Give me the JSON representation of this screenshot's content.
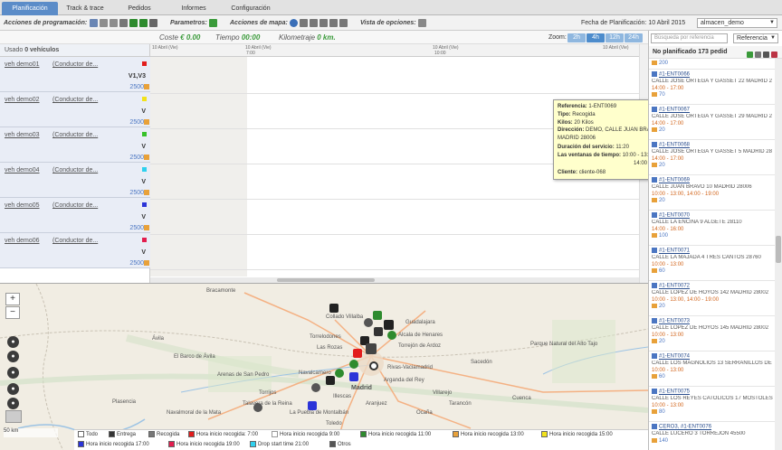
{
  "tabs": [
    "Planificación",
    "Track & trace",
    "Pedidos",
    "Informes",
    "Configuración"
  ],
  "toolbar": {
    "prog_label": "Acciones de programación:",
    "param_label": "Parametros:",
    "map_label": "Acciones de mapa:",
    "view_label": "Vista de opciones:",
    "date_label": "Fecha de Planificación: 10 Abril 2015",
    "warehouse": "almacen_demo"
  },
  "stats": {
    "coste_label": "Coste",
    "coste_value": "€ 0.00",
    "tiempo_label": "Tiempo",
    "tiempo_value": "00:00",
    "km_label": "Kilometraje",
    "km_value": "0 km.",
    "zoom_label": "Zoom:",
    "zoom_options": [
      "2h",
      "4h",
      "12h",
      "24h"
    ]
  },
  "vehicles_header": {
    "label": "Usado",
    "count": "0 vehículos"
  },
  "vehicles": [
    {
      "name": "veh demo01",
      "driver": "(Conductor de...",
      "v": "V1,V3",
      "cap": "2500",
      "color": "#e21d1d"
    },
    {
      "name": "veh demo02",
      "driver": "(Conductor de...",
      "v": "V",
      "cap": "2500",
      "color": "#f2e21a"
    },
    {
      "name": "veh demo03",
      "driver": "(Conductor de...",
      "v": "V",
      "cap": "2500",
      "color": "#36c12b"
    },
    {
      "name": "veh demo04",
      "driver": "(Conductor de...",
      "v": "V",
      "cap": "2500",
      "color": "#2fd0ee"
    },
    {
      "name": "veh demo05",
      "driver": "(Conductor de...",
      "v": "V",
      "cap": "2500",
      "color": "#2b34d8"
    },
    {
      "name": "veh demo06",
      "driver": "(Conductor de...",
      "v": "V",
      "cap": "2500",
      "color": "#e21d4e"
    }
  ],
  "ruler": [
    "10 Abril (Vie)",
    "7:00",
    "10 Abril (Vie)",
    "10:00",
    "10 Abril (Vie)",
    "10 Abril (Vie)"
  ],
  "tooltip": {
    "ref_l": "Referencia:",
    "ref": "1-ENT0069",
    "tipo_l": "Tipo:",
    "tipo": "Recogida",
    "kilos_l": "Kilos:",
    "kilos": "20 Kilos",
    "dir_l": "Dirección:",
    "dir": "DEMO, CALLE JUAN BRAVO 10 MADRID 28006",
    "dur_l": "Duración del servicio:",
    "dur": "11:20",
    "vent_l": "Las ventanas de tiempo:",
    "vent1": "10:00 - 13:00",
    "vent2": "14:00 - 19:00",
    "cli_l": "Cliente:",
    "cli": "cliente-068"
  },
  "right": {
    "search_placeholder": "Búsqueda por referencia",
    "select": "Referencia",
    "header": "No planificado",
    "count": "173 pedid"
  },
  "orders": [
    {
      "ref": "",
      "addr": "",
      "hours": "",
      "kg": "200"
    },
    {
      "ref": "#1-ENT0066",
      "addr": "CALLE JOSE ORTEGA Y GASSET 22 MADRID 2",
      "hours": "14:00 - 17:00",
      "kg": "70"
    },
    {
      "ref": "#1-ENT0067",
      "addr": "CALLE JOSE ORTEGA Y GASSET 29 MADRID 2",
      "hours": "14:00 - 17:00",
      "kg": "20"
    },
    {
      "ref": "#1-ENT0068",
      "addr": "CALLE JOSE ORTEGA Y GASSET 5 MADRID 28",
      "hours": "14:00 - 17:00",
      "kg": "20"
    },
    {
      "ref": "#1-ENT0069",
      "addr": "CALLE JUAN BRAVO 10 MADRID 28006",
      "hours": "10:00 - 13:00, 14:00 - 19:00",
      "kg": "20"
    },
    {
      "ref": "#1-ENT0070",
      "addr": "CALLE LA ENCINA 9 ALGETE 28110",
      "hours": "14:00 - 16:00",
      "kg": "100"
    },
    {
      "ref": "#1-ENT0071",
      "addr": "CALLE LA MAJADA 4 TRES CANTOS 28760",
      "hours": "10:00 - 13:00",
      "kg": "60"
    },
    {
      "ref": "#1-ENT0072",
      "addr": "CALLE LOPEZ DE HOYOS 142 MADRID 28002",
      "hours": "10:00 - 13:00, 14:00 - 19:00",
      "kg": "20"
    },
    {
      "ref": "#1-ENT0073",
      "addr": "CALLE LOPEZ DE HOYOS 145 MADRID 28002",
      "hours": "10:00 - 13:00",
      "kg": "20"
    },
    {
      "ref": "#1-ENT0074",
      "addr": "CALLE LOS MAGNOLIOS 13 SERRANILLOS DE",
      "hours": "10:00 - 13:00",
      "kg": "60"
    },
    {
      "ref": "#1-ENT0075",
      "addr": "CALLE LOS REYES CATOLICOS 17 MOSTOLES",
      "hours": "10:00 - 13:00",
      "kg": "80"
    },
    {
      "ref": "CERO3, #1-ENT0076",
      "addr": "CALLE LUCERO 3 TORREJON 45500",
      "hours": "",
      "kg": "140"
    }
  ],
  "map": {
    "scale": "50 km",
    "cities": [
      "Bracamonte",
      "Collado Villalba",
      "Guadalajara",
      "Alcala de Henares",
      "Torrejón de Ardoz",
      "Las Rozas",
      "Torrelodones",
      "Rivas-Vaciamadrid",
      "Ávila",
      "El Barco de Ávila",
      "Arenas de San Pedro",
      "Navalcarnero",
      "Illescas",
      "Aranjuez",
      "Arganda del Rey",
      "Tarancón",
      "Cuenca",
      "Plasencia",
      "Navalmoral de la Mata",
      "Talavera de la Reina",
      "La Puebla de Montalbán",
      "Toledo",
      "Parque Natural del Alto Tajo",
      "Sacedón",
      "Villarejo",
      "Ocaña",
      "Torrijos",
      "Madrid"
    ]
  },
  "legend": [
    "Todo",
    "Entrega",
    "Recogida",
    "Hora inicio recogida: 7:00",
    "Hora inicio recogida 9:00",
    "Hora inicio recogida 11:00",
    "Hora inicio recogida 13:00",
    "Hora inicio recogida 15:00",
    "Hora inicio recogida 17:00",
    "Hora inicio recogida 19:00",
    "Drop start time 21:00",
    "Otros"
  ]
}
